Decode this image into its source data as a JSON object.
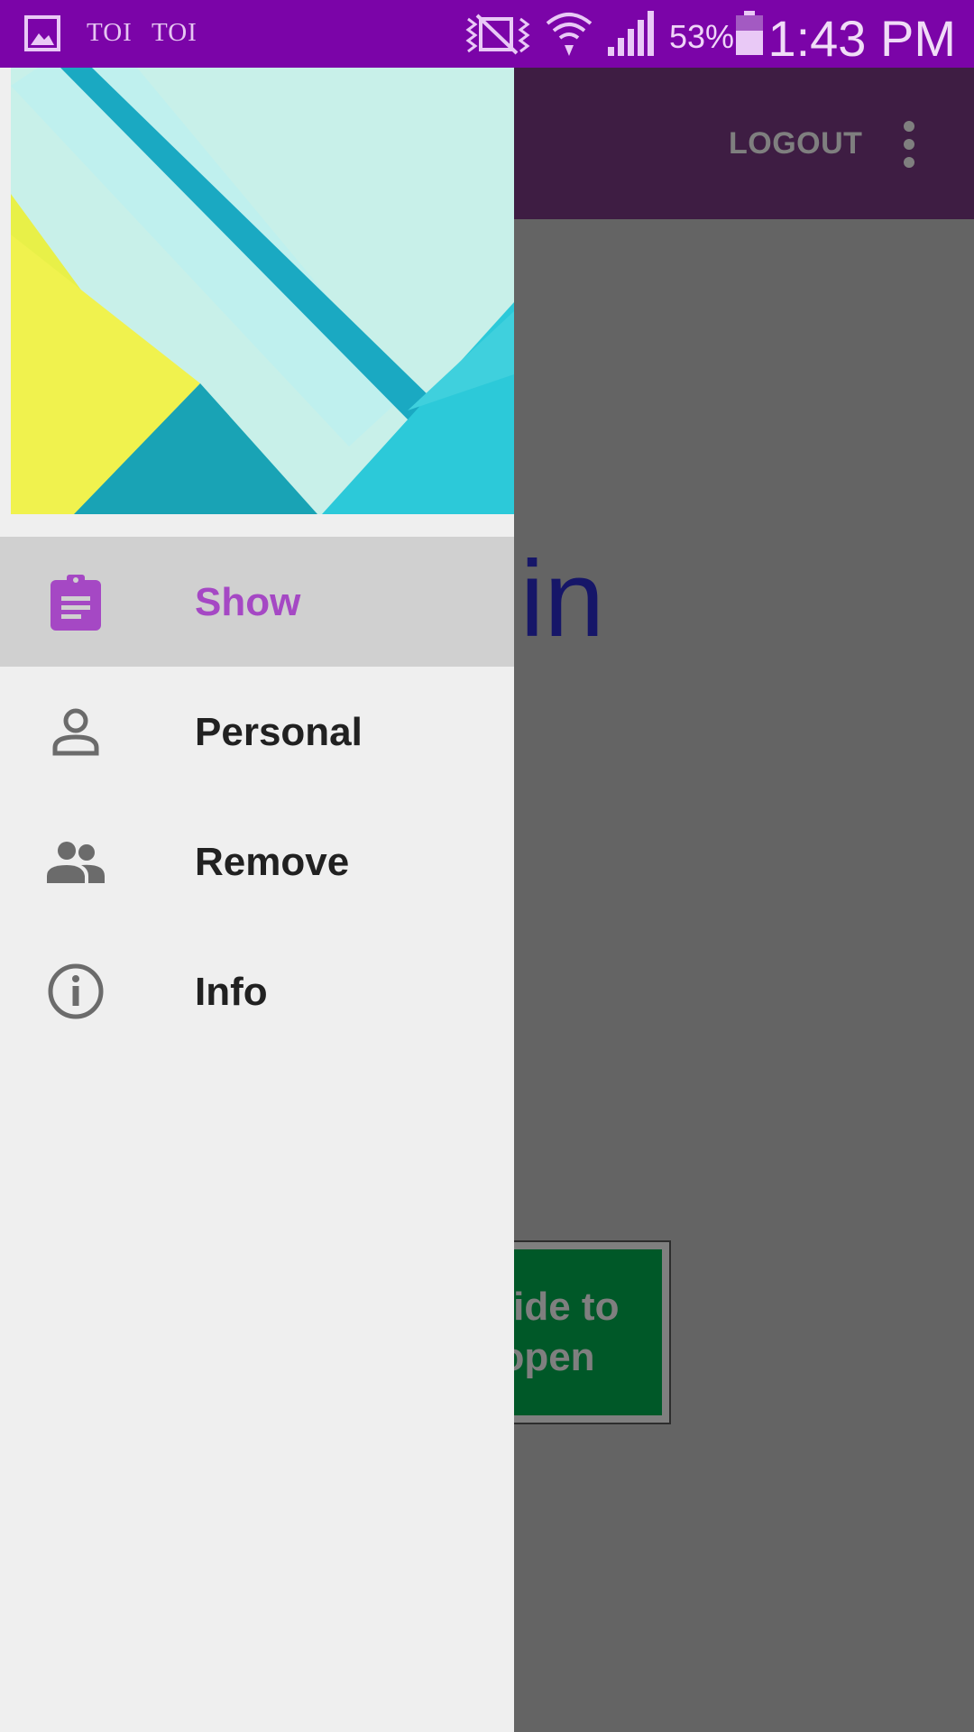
{
  "status_bar": {
    "app_notifications": [
      "TOI",
      "TOI"
    ],
    "battery_percent": "53%",
    "time": "1:43 PM",
    "icons": [
      "gallery-icon",
      "mute-icon",
      "wifi-icon",
      "signal-icon",
      "battery-icon"
    ]
  },
  "toolbar": {
    "logout_label": "LOGOUT",
    "menu_icon": "overflow-menu-icon"
  },
  "content": {
    "welcome_text": "Admin",
    "slide_button_label": "Slide to open"
  },
  "drawer": {
    "items": [
      {
        "label": "Show",
        "icon": "clipboard-icon",
        "selected": true
      },
      {
        "label": "Personal",
        "icon": "person-icon",
        "selected": false
      },
      {
        "label": "Remove",
        "icon": "people-icon",
        "selected": false
      },
      {
        "label": "Info",
        "icon": "info-icon",
        "selected": false
      }
    ]
  },
  "colors": {
    "status_bar": "#7b04a8",
    "toolbar": "#7d3a86",
    "accent": "#a548c4",
    "drawer_bg": "#efefef",
    "selected_bg": "#d0d0d0",
    "welcome_text": "#2c2cd0",
    "slide_button": "#00b050"
  }
}
